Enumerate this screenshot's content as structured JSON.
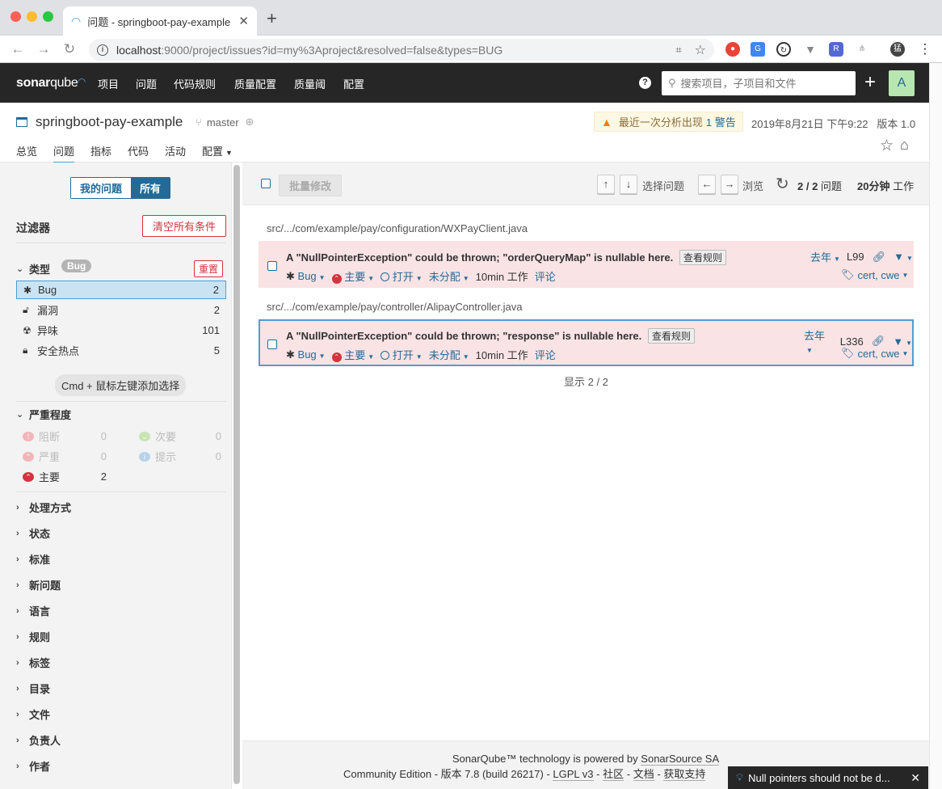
{
  "browser": {
    "tab_title": "问题 - springboot-pay-example",
    "url_host": "localhost",
    "url_rest": ":9000/project/issues?id=my%3Aproject&resolved=false&types=BUG",
    "profile_letter": "猛"
  },
  "nav": {
    "logo_a": "sonar",
    "logo_b": "qube",
    "items": [
      "项目",
      "问题",
      "代码规则",
      "质量配置",
      "质量阈",
      "配置"
    ],
    "help": "?",
    "search_placeholder": "搜索项目，子项目和文件",
    "plus": "+",
    "avatar": "A"
  },
  "project": {
    "name": "springboot-pay-example",
    "branch": "master",
    "warning_text": "最近一次分析出现",
    "warning_link": "1 警告",
    "analysis_date": "2019年8月21日 下午9:22",
    "version": "版本 1.0",
    "tabs": [
      "总览",
      "问题",
      "指标",
      "代码",
      "活动",
      "配置"
    ]
  },
  "sidebar": {
    "my_issues": "我的问题",
    "all": "所有",
    "filters_title": "过滤器",
    "clear_all": "清空所有条件",
    "type": {
      "title": "类型",
      "badge": "Bug",
      "reset": "重置",
      "items": [
        {
          "label": "Bug",
          "count": "2",
          "icon": "bug-icon"
        },
        {
          "label": "漏洞",
          "count": "2",
          "icon": "lock-icon"
        },
        {
          "label": "异味",
          "count": "101",
          "icon": "radiation-icon"
        },
        {
          "label": "安全热点",
          "count": "5",
          "icon": "shield-lock-icon"
        }
      ]
    },
    "cmd_hint": "Cmd + 鼠标左键添加选择",
    "severity": {
      "title": "严重程度",
      "items": [
        {
          "label": "阻断",
          "count": "0"
        },
        {
          "label": "次要",
          "count": "0"
        },
        {
          "label": "严重",
          "count": "0"
        },
        {
          "label": "提示",
          "count": "0"
        },
        {
          "label": "主要",
          "count": "2"
        }
      ]
    },
    "collapsed": [
      "处理方式",
      "状态",
      "标准",
      "新问题",
      "语言",
      "规则",
      "标签",
      "目录",
      "文件",
      "负责人",
      "作者"
    ]
  },
  "toolbar": {
    "bulk": "批量修改",
    "up": "↑",
    "down": "↓",
    "select_issue": "选择问题",
    "left": "←",
    "right": "→",
    "browse": "浏览",
    "count": "2 / 2",
    "count_unit": "问题",
    "effort": "20分钟",
    "effort_unit": "工作"
  },
  "issues": [
    {
      "path": "src/.../com/example/pay/configuration/WXPayClient.java",
      "message": "A \"NullPointerException\" could be thrown; \"orderQueryMap\" is nullable here.",
      "rule_button": "查看规则",
      "type": "Bug",
      "severity": "主要",
      "status": "打开",
      "assignee": "未分配",
      "effort": "10min 工作",
      "comment": "评论",
      "when": "去年",
      "line": "L99",
      "tags": "cert, cwe"
    },
    {
      "path": "src/.../com/example/pay/controller/AlipayController.java",
      "message": "A \"NullPointerException\" could be thrown; \"response\" is nullable here.",
      "rule_button": "查看规则",
      "type": "Bug",
      "severity": "主要",
      "status": "打开",
      "assignee": "未分配",
      "effort": "10min 工作",
      "comment": "评论",
      "when": "去年",
      "line": "L336",
      "tags": "cert, cwe"
    }
  ],
  "showing": "显示 2 / 2",
  "footer": {
    "line1_a": "SonarQube™ technology is powered by",
    "line1_b": "SonarSource SA",
    "line2_a": "Community Edition - 版本 7.8 (build 26217) -",
    "lgpl": "LGPL v3",
    "community": "社区",
    "docs": "文档",
    "support": "获取支持",
    "sep": "-"
  },
  "toast": "Null pointers should not be d...",
  "colors": {
    "nav_bg": "#262626",
    "accent": "#236a97",
    "issue_bg": "#f9e3e4",
    "danger": "#d4333f",
    "selected": "#4b9fd5"
  }
}
